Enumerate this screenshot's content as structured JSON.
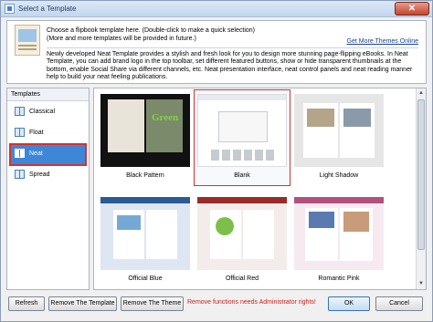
{
  "window": {
    "title": "Select a Template",
    "close_glyph": "✕"
  },
  "info": {
    "line1": "Choose a flipbook template here. (Double-click to make a quick selection)",
    "line2": "(More and more templates will be provided in future.)",
    "link": "Get More Themes Online",
    "description": "Newly developed Neat Template provides a stylish and fresh look for you to design more stunning page-flipping eBooks. In Neat Template, you can add brand logo in the top toolbar, set different featured buttons, show or hide transparent thumbnails at the bottom, enable Social Share via different channels, etc. Neat presentation interface, neat control panels and neat reading manner help to build your neat feeling publications."
  },
  "sidebar": {
    "header": "Templates",
    "items": [
      {
        "label": "Classical",
        "selected": false
      },
      {
        "label": "Float",
        "selected": false
      },
      {
        "label": "Neat",
        "selected": true
      },
      {
        "label": "Spread",
        "selected": false
      }
    ]
  },
  "templates": [
    {
      "label": "Black Pattern",
      "thumb_text": "Green"
    },
    {
      "label": "Blank",
      "selected": true
    },
    {
      "label": "Light Shadow"
    },
    {
      "label": "Official Blue"
    },
    {
      "label": "Official Red"
    },
    {
      "label": "Romantic Pink"
    }
  ],
  "footer": {
    "refresh": "Refresh",
    "remove_template": "Remove The Template",
    "remove_theme": "Remove The Theme",
    "warning": "Remove functions needs Administrator rights!",
    "ok": "OK",
    "cancel": "Cancel"
  },
  "colors": {
    "accent": "#3d86d8",
    "highlight_border": "#d9302a",
    "warning": "#c9211e"
  }
}
